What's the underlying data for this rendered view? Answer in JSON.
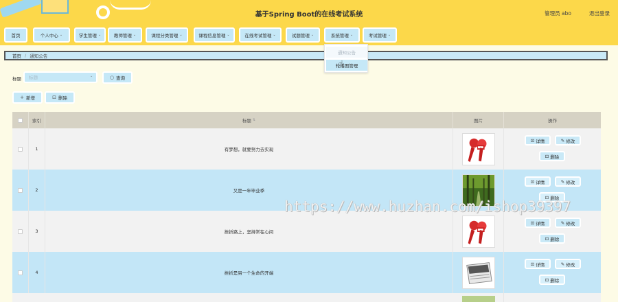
{
  "header": {
    "title": "基于Spring Boot的在线考试系统",
    "user": "管理员 abo",
    "logout": "退出登录"
  },
  "nav": {
    "items": [
      {
        "label": "首页",
        "caret": false
      },
      {
        "label": "个人中心",
        "caret": true
      },
      {
        "label": "学生管理",
        "caret": true
      },
      {
        "label": "教师管理",
        "caret": true
      },
      {
        "label": "课程分类管理",
        "caret": true
      },
      {
        "label": "课程信息管理",
        "caret": true
      },
      {
        "label": "在线考试管理",
        "caret": true
      },
      {
        "label": "试题管理",
        "caret": true
      },
      {
        "label": "系统管理",
        "caret": true
      },
      {
        "label": "考试管理",
        "caret": true
      }
    ],
    "caret_glyph": "⌄"
  },
  "dropdown": {
    "items": [
      "通知公告",
      "轮播图管理"
    ]
  },
  "breadcrumb": {
    "home": "首页",
    "separator": "/",
    "current": "通知公告"
  },
  "search": {
    "label": "标题",
    "placeholder": "标题",
    "query_label": "查询"
  },
  "actions": {
    "add_label": "新增",
    "delete_label": "删除"
  },
  "table": {
    "headers": {
      "index": "索引",
      "title": "标题",
      "image": "图片",
      "ops": "操作"
    },
    "op_labels": {
      "detail": "详情",
      "edit": "修改",
      "delete": "删除"
    },
    "rows": [
      {
        "index": "1",
        "title": "有梦想，就要努力去实现",
        "image": "microphone"
      },
      {
        "index": "2",
        "title": "又是一年毕业季",
        "image": "forest"
      },
      {
        "index": "3",
        "title": "挫折路上，坚持常在心间",
        "image": "microphone"
      },
      {
        "index": "4",
        "title": "挫折是另一个生命的开端",
        "image": "news"
      }
    ]
  },
  "watermark": "https://www.huzhan.com/ishop39397",
  "colors": {
    "header_bg": "#fcd84a",
    "button_bg": "#c5e8f7",
    "row_alt": "#c3e6f7",
    "page_bg": "#fdfbe6"
  }
}
